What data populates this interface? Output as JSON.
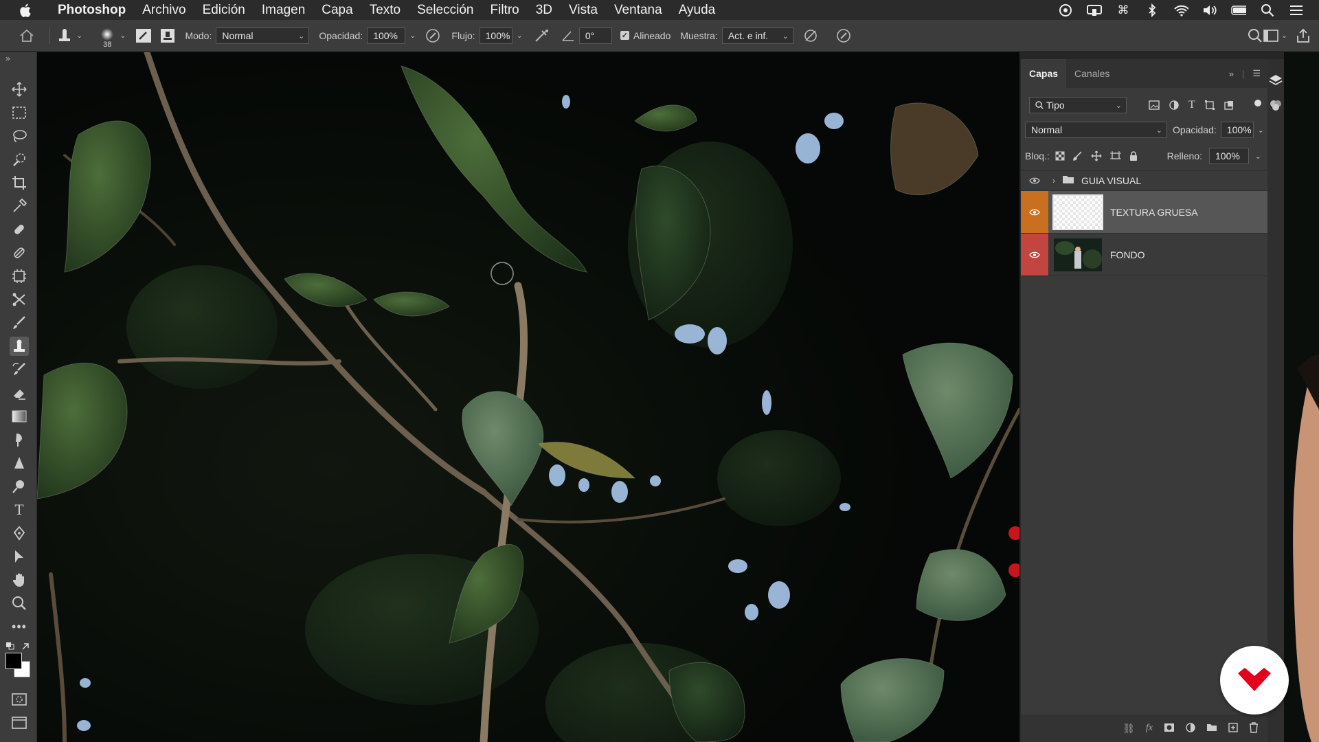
{
  "menubar": {
    "app_name": "Photoshop",
    "items": [
      "Archivo",
      "Edición",
      "Imagen",
      "Capa",
      "Texto",
      "Selección",
      "Filtro",
      "3D",
      "Vista",
      "Ventana",
      "Ayuda"
    ]
  },
  "options": {
    "brush_size": "38",
    "mode_label": "Modo:",
    "mode_value": "Normal",
    "opacity_label": "Opacidad:",
    "opacity_value": "100%",
    "flow_label": "Flujo:",
    "flow_value": "100%",
    "angle_value": "0°",
    "aligned_label": "Alineado",
    "aligned_checked": true,
    "sample_label": "Muestra:",
    "sample_value": "Act. e inf."
  },
  "layers_panel": {
    "tabs": [
      "Capas",
      "Canales"
    ],
    "active_tab": "Capas",
    "filter_placeholder": "Tipo",
    "blend_mode": "Normal",
    "opacity_label": "Opacidad:",
    "opacity_value": "100%",
    "lock_label": "Bloq.:",
    "fill_label": "Relleno:",
    "fill_value": "100%",
    "layers": [
      {
        "name": "GUIA VISUAL",
        "type": "group",
        "visible": true,
        "color": "none"
      },
      {
        "name": "TEXTURA GRUESA",
        "type": "pixel",
        "visible": true,
        "color": "orange",
        "selected": true
      },
      {
        "name": "FONDO",
        "type": "pixel",
        "visible": true,
        "color": "red"
      }
    ]
  },
  "colors": {
    "accent_orange": "#c8701f",
    "accent_red": "#c4443f",
    "brand_red": "#e2001a"
  }
}
